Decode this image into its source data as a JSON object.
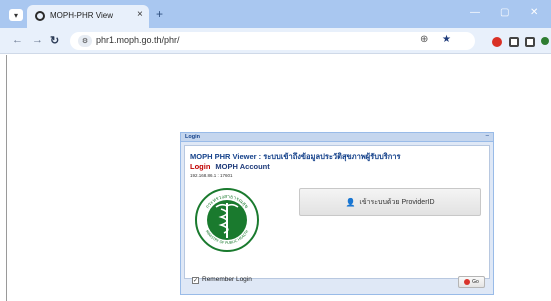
{
  "browser": {
    "tab_title": "MOPH-PHR View",
    "tab_close": "×",
    "new_tab": "+",
    "url": "phr1.moph.go.th/phr/",
    "win_minimize": "—",
    "win_maximize": "▢",
    "win_close": "✕"
  },
  "login_window": {
    "header_title": "Login",
    "collapse_glyph": "–",
    "app_title": "MOPH PHR Viewer : ระบบเข้าถึงข้อมูลประวัติสุขภาพผู้รับบริการ",
    "login_word": "Login",
    "account_label": "MOPH Account",
    "ip_port": "192.168.86.1 : 17601",
    "provider_button_label": "เข้าระบบด้วย ProviderID",
    "remember_login": "Remember Login",
    "remember_checked": true,
    "go_label": "Go",
    "seal_text_top": "กระทรวงสาธารณสุข",
    "seal_text_bottom": "MINISTRY OF PUBLIC HEALTH"
  },
  "colors": {
    "chrome_titlebar": "#a9c7f0",
    "chrome_toolbar": "#e8f0fb",
    "seal_green": "#1a7a2e",
    "login_red": "#c00000",
    "title_blue": "#15428b"
  },
  "icons": {
    "back": "arrow-left-icon",
    "forward": "arrow-right-icon",
    "reload": "reload-icon",
    "site_info": "tune-icon",
    "zoom": "zoom-icon",
    "bookmark": "star-icon",
    "user": "user-icon"
  }
}
